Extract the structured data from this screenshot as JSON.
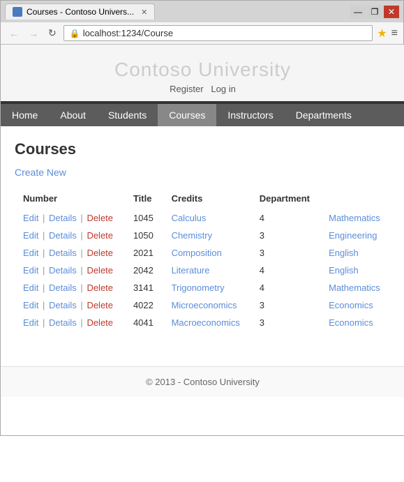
{
  "browser": {
    "tab_title": "Courses - Contoso Univers...",
    "url": "localhost:1234/Course",
    "back_btn": "←",
    "forward_btn": "→",
    "refresh_btn": "↻"
  },
  "site": {
    "title": "Contoso University",
    "auth": {
      "register": "Register",
      "login": "Log in"
    },
    "nav": [
      "Home",
      "About",
      "Students",
      "Courses",
      "Instructors",
      "Departments"
    ]
  },
  "page": {
    "heading": "Courses",
    "create_new": "Create New",
    "table": {
      "headers": [
        "Number",
        "Title",
        "Credits",
        "Department"
      ],
      "rows": [
        {
          "number": "1045",
          "title": "Calculus",
          "credits": "4",
          "department": "Mathematics"
        },
        {
          "number": "1050",
          "title": "Chemistry",
          "credits": "3",
          "department": "Engineering"
        },
        {
          "number": "2021",
          "title": "Composition",
          "credits": "3",
          "department": "English"
        },
        {
          "number": "2042",
          "title": "Literature",
          "credits": "4",
          "department": "English"
        },
        {
          "number": "3141",
          "title": "Trigonometry",
          "credits": "4",
          "department": "Mathematics"
        },
        {
          "number": "4022",
          "title": "Microeconomics",
          "credits": "3",
          "department": "Economics"
        },
        {
          "number": "4041",
          "title": "Macroeconomics",
          "credits": "3",
          "department": "Economics"
        }
      ],
      "actions": {
        "edit": "Edit",
        "details": "Details",
        "delete": "Delete"
      }
    }
  },
  "footer": {
    "copyright": "© 2013 - Contoso University"
  }
}
